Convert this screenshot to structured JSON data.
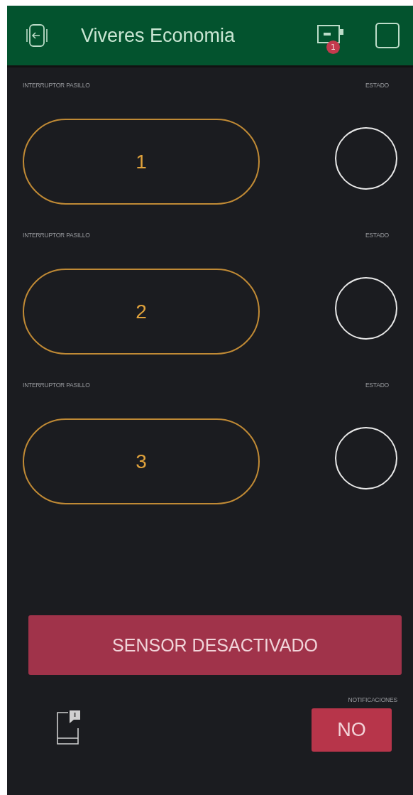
{
  "header": {
    "title": "Viveres Economia",
    "badge": "1"
  },
  "switches": [
    {
      "label": "INTERRUPTOR PASILLO",
      "button": "1",
      "state_label": "ESTADO",
      "on": false
    },
    {
      "label": "INTERRUPTOR PASILLO",
      "button": "2",
      "state_label": "ESTADO",
      "on": false
    },
    {
      "label": "INTERRUPTOR PASILLO",
      "button": "3",
      "state_label": "ESTADO",
      "on": false
    }
  ],
  "sensor_button": "SENSOR DESACTIVADO",
  "notifications": {
    "label": "NOTIFICACIONES",
    "button": "NO"
  }
}
